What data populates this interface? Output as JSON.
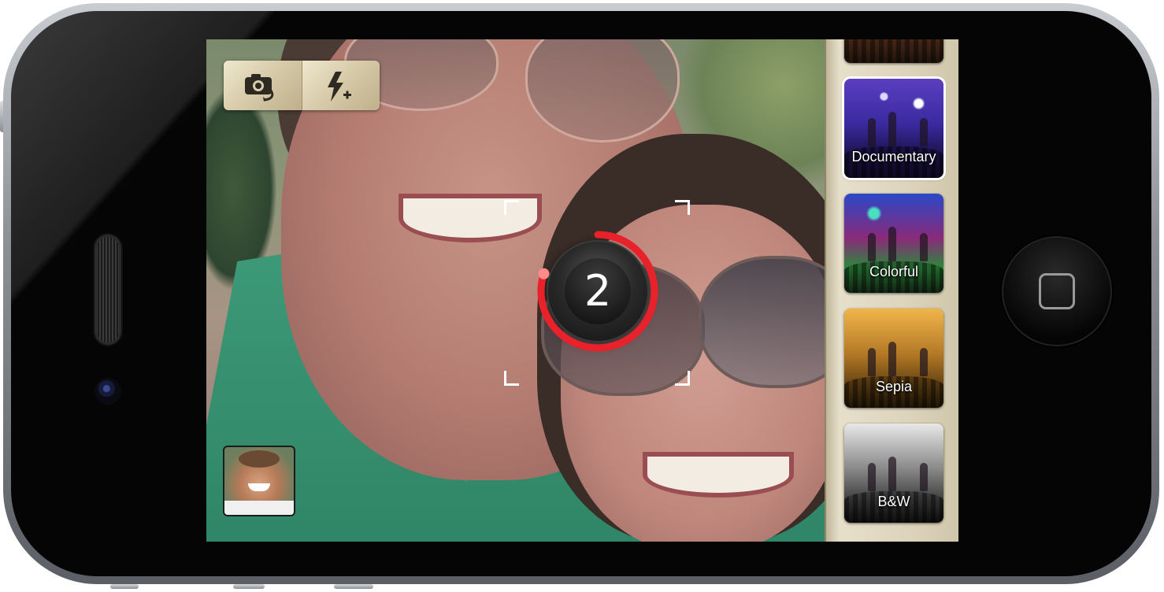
{
  "app": {
    "toolbar": {
      "switch_camera_icon": "camera-switch-icon",
      "flash_icon": "flash-auto-icon"
    },
    "countdown": {
      "value": "2",
      "progress": 0.8,
      "ring_color": "#e8212b"
    },
    "self_view": {
      "icon": "self-view-thumbnail"
    },
    "filters": [
      {
        "label": "",
        "selected": false
      },
      {
        "label": "Documentary",
        "selected": true
      },
      {
        "label": "Colorful",
        "selected": false
      },
      {
        "label": "Sepia",
        "selected": false
      },
      {
        "label": "B&W",
        "selected": false
      }
    ],
    "colors": {
      "toolbar_gold": "#d8ccab",
      "sidebar_bg": "#ddd4bc",
      "focus_bracket": "#ffffff"
    }
  }
}
